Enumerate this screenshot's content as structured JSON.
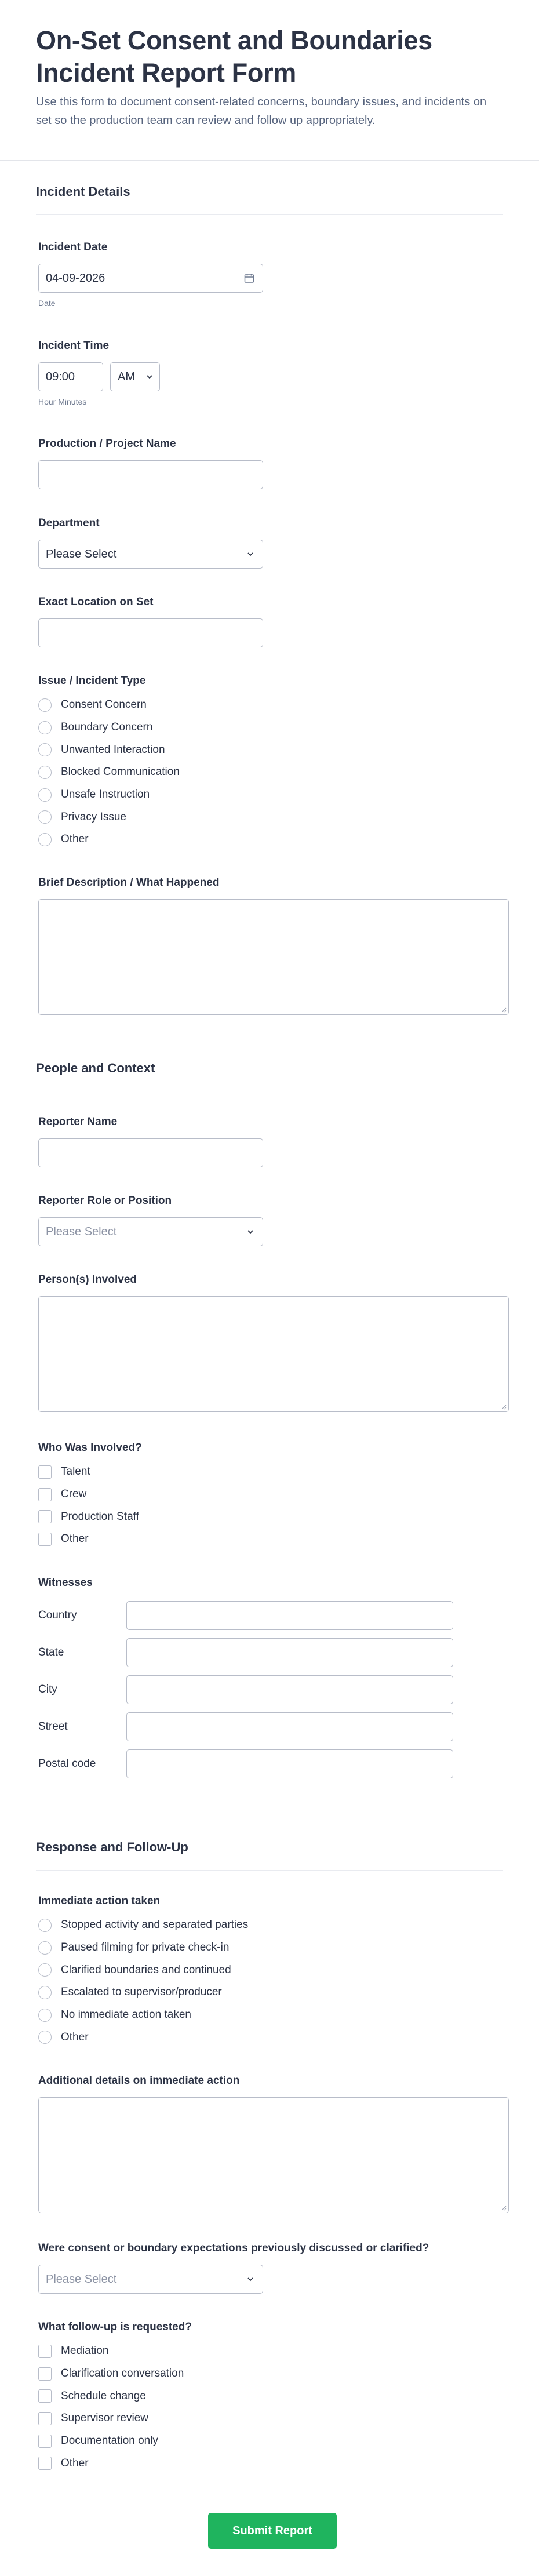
{
  "header": {
    "title": "On-Set Consent and Boundaries Incident Report Form",
    "subtitle": "Use this form to document consent-related concerns, boundary issues, and incidents on set so the production team can review and follow up appropriately."
  },
  "sections": {
    "incident": {
      "title": "Incident Details",
      "date_label": "Incident Date",
      "date_value": "04-09-2026",
      "date_sublabel": "Date",
      "time_label": "Incident Time",
      "time_value": "09:00",
      "ampm_value": "AM",
      "time_sublabel": "Hour Minutes",
      "production_label": "Production / Project Name",
      "department_label": "Department",
      "department_value": "Please Select",
      "location_label": "Exact Location on Set",
      "issue_label": "Issue / Incident Type",
      "issue_options": [
        "Consent Concern",
        "Boundary Concern",
        "Unwanted Interaction",
        "Blocked Communication",
        "Unsafe Instruction",
        "Privacy Issue",
        "Other"
      ],
      "description_label": "Brief Description / What Happened"
    },
    "people": {
      "title": "People and Context",
      "reporter_name_label": "Reporter Name",
      "reporter_role_label": "Reporter Role or Position",
      "reporter_role_value": "Please Select",
      "persons_label": "Person(s) Involved",
      "who_label": "Who Was Involved?",
      "who_options": [
        "Talent",
        "Crew",
        "Production Staff",
        "Other"
      ],
      "witnesses_label": "Witnesses",
      "address_fields": [
        "Country",
        "State",
        "City",
        "Street",
        "Postal code"
      ]
    },
    "response": {
      "title": "Response and Follow-Up",
      "action_label": "Immediate action taken",
      "action_options": [
        "Stopped activity and separated parties",
        "Paused filming for private check-in",
        "Clarified boundaries and continued",
        "Escalated to supervisor/producer",
        "No immediate action taken",
        "Other"
      ],
      "details_label": "Additional details on immediate action",
      "discussed_label": "Were consent or boundary expectations previously discussed or clarified?",
      "discussed_value": "Please Select",
      "followup_label": "What follow-up is requested?",
      "followup_options": [
        "Mediation",
        "Clarification conversation",
        "Schedule change",
        "Supervisor review",
        "Documentation only",
        "Other"
      ]
    }
  },
  "submit_label": "Submit Report",
  "colors": {
    "accent": "#1fb45e",
    "text": "#2c3345",
    "border": "#b8bdc9"
  },
  "icons": {
    "date": "calendar-icon",
    "select": "chevron-down-icon",
    "resize": "resize-grip-icon"
  }
}
